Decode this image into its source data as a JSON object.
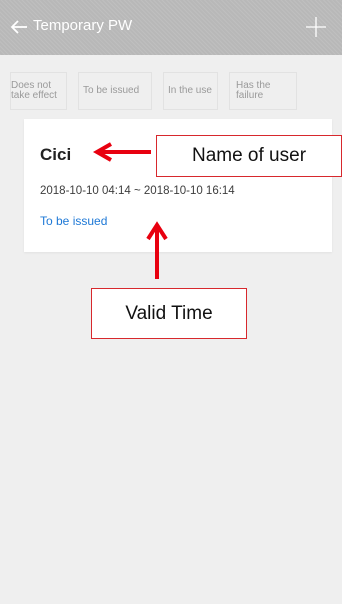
{
  "header": {
    "title": "Temporary PW",
    "back_icon": "back-arrow-icon",
    "add_icon": "plus-icon",
    "background": "#b8b8b8"
  },
  "filters": [
    {
      "label": "Does not take effect"
    },
    {
      "label": "To be issued"
    },
    {
      "label": "In the use"
    },
    {
      "label": "Has the failure"
    }
  ],
  "password_card": {
    "user_name": "Cici",
    "valid_time": "2018-10-10 04:14 ~ 2018-10-10 16:14",
    "status": "To be issued",
    "status_color": "#1d78d6"
  },
  "annotations": {
    "name_label": "Name of user",
    "time_label": "Valid Time",
    "arrow_color": "#e8000f"
  }
}
